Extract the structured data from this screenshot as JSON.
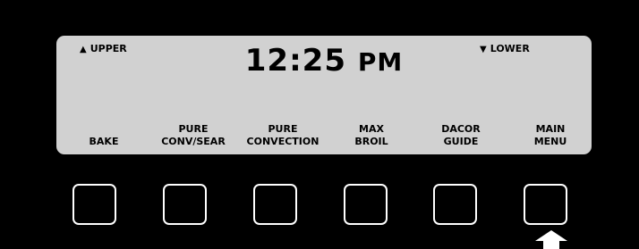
{
  "display": {
    "upper_indicator": {
      "icon": "triangle-up-icon",
      "glyph": "▲",
      "label": "UPPER"
    },
    "lower_indicator": {
      "icon": "triangle-down-icon",
      "glyph": "▼",
      "label": "LOWER"
    },
    "time": "12:25",
    "ampm": "PM"
  },
  "softkeys": [
    {
      "line1": "",
      "line2": "BAKE"
    },
    {
      "line1": "PURE",
      "line2": "CONV/SEAR"
    },
    {
      "line1": "PURE",
      "line2": "CONVECTION"
    },
    {
      "line1": "MAX",
      "line2": "BROIL"
    },
    {
      "line1": "DACOR",
      "line2": "GUIDE"
    },
    {
      "line1": "MAIN",
      "line2": "MENU"
    }
  ],
  "pointer": {
    "icon": "arrow-up-icon",
    "target_key": "MAIN MENU"
  },
  "colors": {
    "background": "#000000",
    "lcd": "#d1d1d1",
    "text": "#000000",
    "key_border": "#ffffff"
  }
}
